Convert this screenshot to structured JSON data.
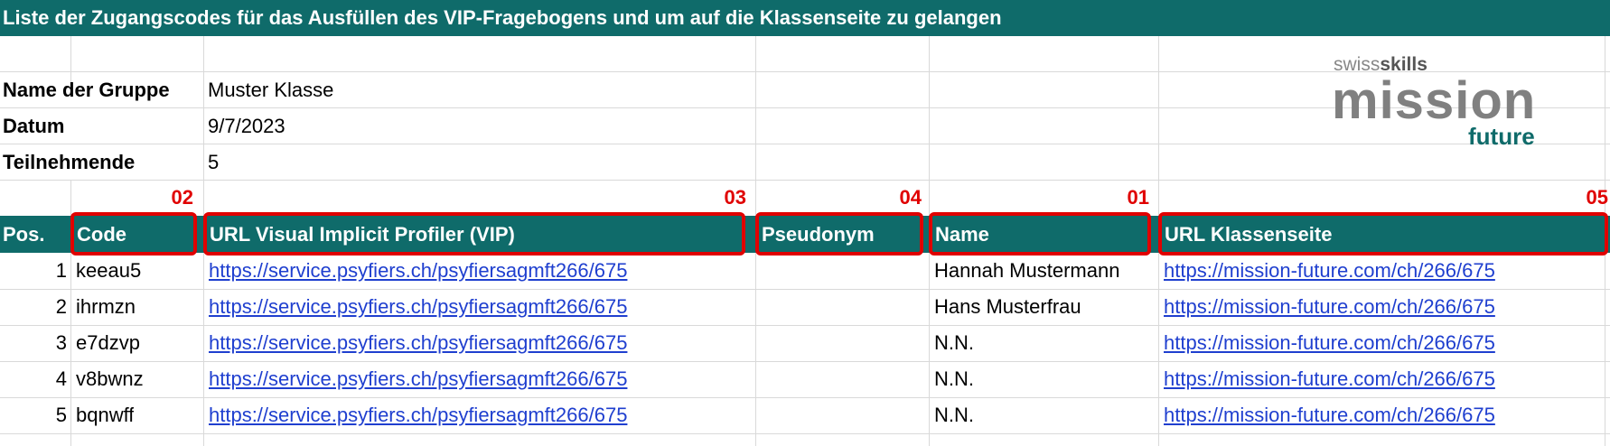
{
  "title": "Liste der Zugangscodes für das Ausfüllen des VIP-Fragebogens und um auf die Klassenseite zu gelangen",
  "info": {
    "group_label": "Name der Gruppe",
    "group_value": "Muster Klasse",
    "date_label": "Datum",
    "date_value": "9/7/2023",
    "participants_label": "Teilnehmende",
    "participants_value": "5"
  },
  "logo": {
    "top_prefix": "swiss",
    "top_suffix": "skills",
    "main": "mission",
    "sub": "future"
  },
  "markers": {
    "code": "02",
    "vip": "03",
    "pseudonym": "04",
    "name": "01",
    "klassenseite": "05"
  },
  "columns": {
    "pos": "Pos.",
    "code": "Code",
    "vip": "URL Visual Implicit Profiler (VIP)",
    "pseudonym": "Pseudonym",
    "name": "Name",
    "klassenseite": "URL Klassenseite"
  },
  "rows": [
    {
      "pos": "1",
      "code": "keeau5",
      "vip": "https://service.psyfiers.ch/psyfiersagmft266/675",
      "pseudonym": "",
      "name": "Hannah Mustermann",
      "klassenseite": "https://mission-future.com/ch/266/675"
    },
    {
      "pos": "2",
      "code": "ihrmzn",
      "vip": "https://service.psyfiers.ch/psyfiersagmft266/675",
      "pseudonym": "",
      "name": "Hans Musterfrau",
      "klassenseite": "https://mission-future.com/ch/266/675"
    },
    {
      "pos": "3",
      "code": "e7dzvp",
      "vip": "https://service.psyfiers.ch/psyfiersagmft266/675",
      "pseudonym": "",
      "name": "N.N.",
      "klassenseite": "https://mission-future.com/ch/266/675"
    },
    {
      "pos": "4",
      "code": "v8bwnz",
      "vip": "https://service.psyfiers.ch/psyfiersagmft266/675",
      "pseudonym": "",
      "name": "N.N.",
      "klassenseite": "https://mission-future.com/ch/266/675"
    },
    {
      "pos": "5",
      "code": "bqnwff",
      "vip": "https://service.psyfiers.ch/psyfiersagmft266/675",
      "pseudonym": "",
      "name": "N.N.",
      "klassenseite": "https://mission-future.com/ch/266/675"
    }
  ]
}
